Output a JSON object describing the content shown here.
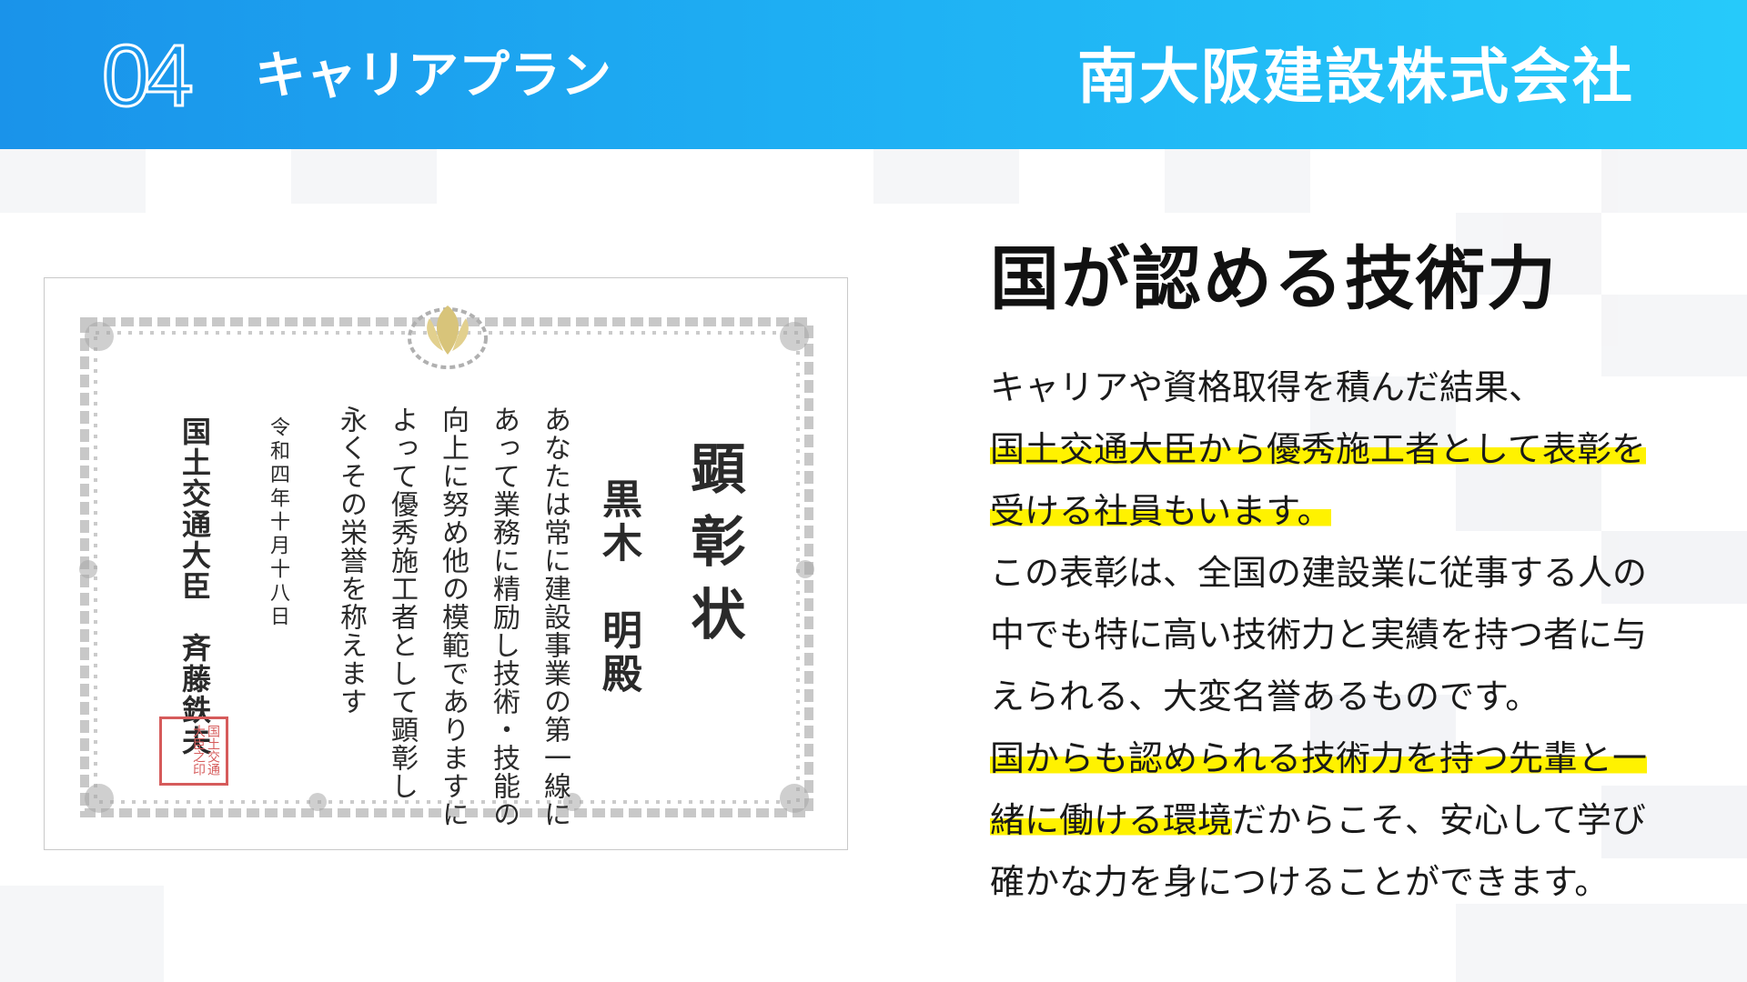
{
  "header": {
    "number": "04",
    "section_title": "キャリアプラン",
    "company": "南大阪建設株式会社",
    "gradient": [
      "#1a93ea",
      "#26cafa"
    ]
  },
  "certificate": {
    "title": "顕彰状",
    "recipient": "黒木　明殿",
    "body_lines": [
      "あなたは常に建設事業の第一線に",
      "あって業務に精励し技術・技能の",
      "向上に努め他の模範でありますに",
      "よって優秀施工者として顕彰し",
      "永くその栄誉を称えます"
    ],
    "date": "令和四年十月十八日",
    "signatory": "国土交通大臣　斉藤鉄夫",
    "seal_text": "国土交通大臣之印",
    "crest_color": "#d8c47a",
    "seal_color": "#d65b5b"
  },
  "content": {
    "heading": "国が認める技術力",
    "highlight_color": "#fff200",
    "lines": [
      {
        "text": "キャリアや資格取得を積んだ結果、",
        "highlight": false
      },
      {
        "text": "国土交通大臣から優秀施工者として表彰を",
        "highlight": true
      },
      {
        "text": "受ける社員もいます。",
        "highlight": true
      },
      {
        "text": "この表彰は、全国の建設業に従事する人の",
        "highlight": false
      },
      {
        "text": "中でも特に高い技術力と実績を持つ者に与",
        "highlight": false
      },
      {
        "text": "えられる、大変名誉あるものです。",
        "highlight": false
      },
      {
        "text": "国からも認められる技術力を持つ先輩と一",
        "highlight": true
      },
      {
        "segments": [
          {
            "text": "緒に働ける環境",
            "highlight": true
          },
          {
            "text": "だからこそ、安心して学び",
            "highlight": false
          }
        ]
      },
      {
        "text": "確かな力を身につけることができます。",
        "highlight": false
      }
    ]
  }
}
